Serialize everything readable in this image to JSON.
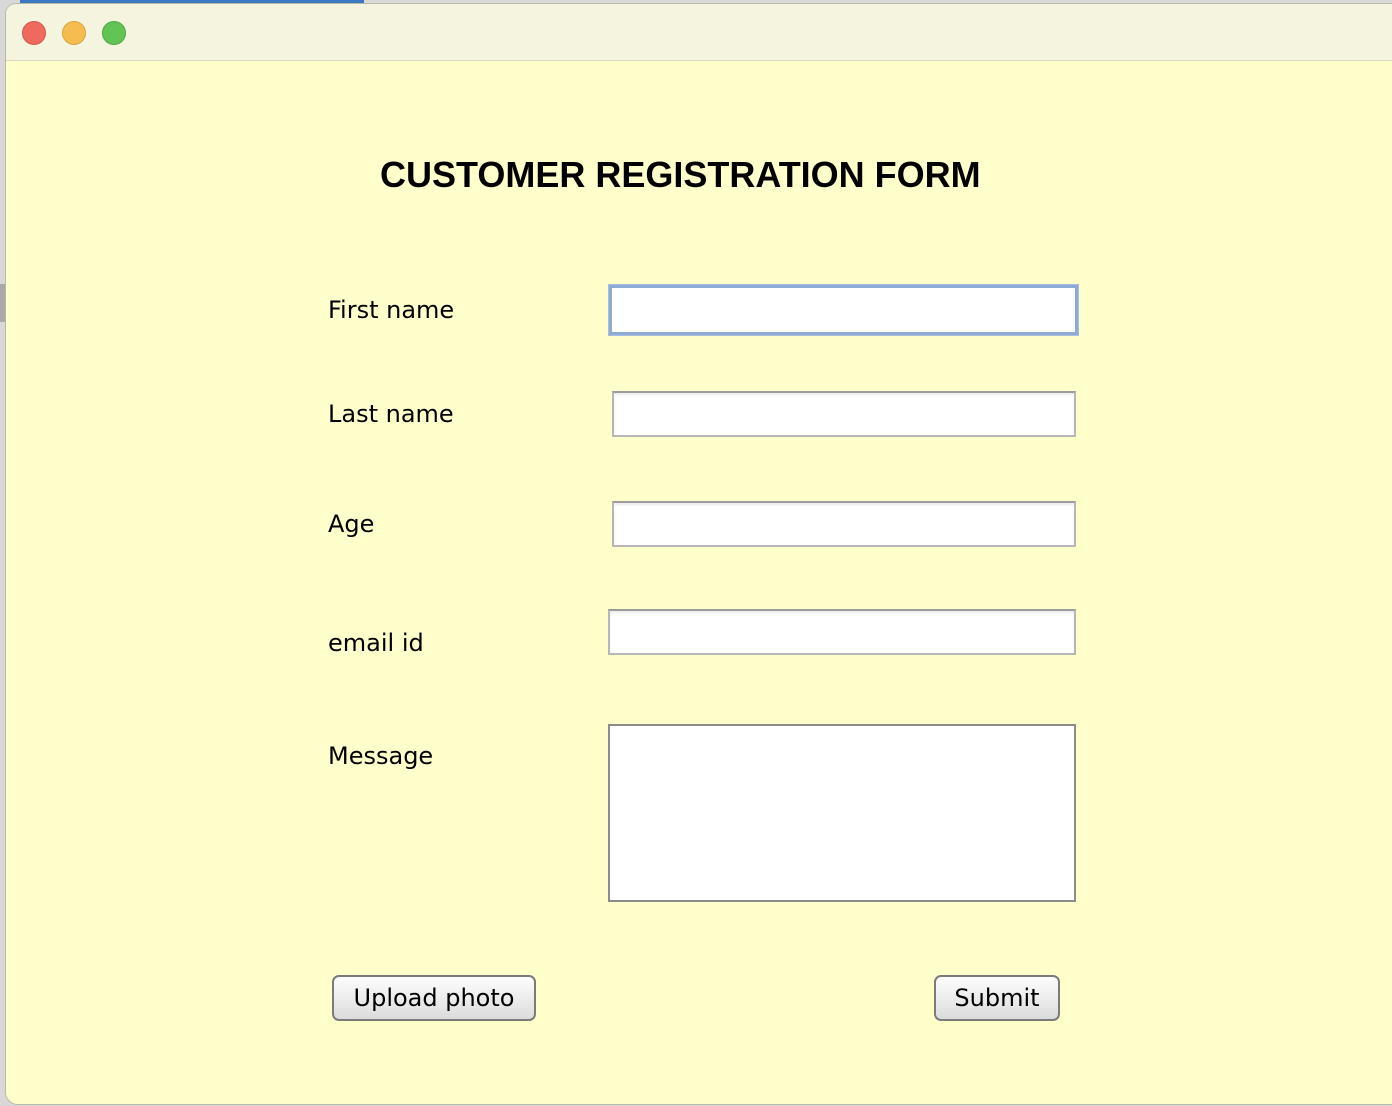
{
  "window": {
    "controls": {
      "close": "close-icon",
      "minimize": "minimize-icon",
      "zoom": "zoom-icon"
    },
    "colors": {
      "background": "#ffffcc",
      "titlebar": "#f5f4df",
      "close": "#ee6a5e",
      "minimize": "#f5bd4f",
      "zoom": "#61c454"
    }
  },
  "form": {
    "title": "CUSTOMER REGISTRATION FORM",
    "fields": {
      "first_name": {
        "label": "First name",
        "value": ""
      },
      "last_name": {
        "label": "Last name",
        "value": ""
      },
      "age": {
        "label": "Age",
        "value": ""
      },
      "email": {
        "label": "email id",
        "value": ""
      },
      "message": {
        "label": "Message",
        "value": ""
      }
    },
    "buttons": {
      "upload": "Upload photo",
      "submit": "Submit"
    }
  }
}
